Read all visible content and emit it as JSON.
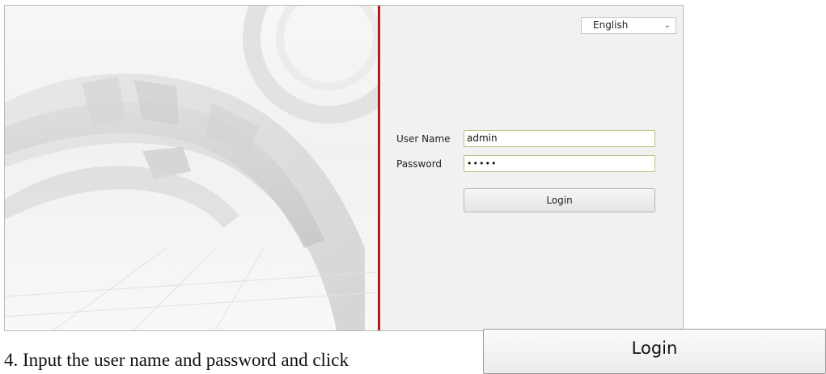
{
  "login_panel": {
    "language": {
      "selected": "English",
      "chevron_icon": "chevron-down-icon"
    },
    "fields": {
      "username_label": "User Name",
      "username_value": "admin",
      "password_label": "Password",
      "password_value": "•••••"
    },
    "login_label": "Login"
  },
  "instruction": {
    "text": "4. Input the user name and password and click",
    "button_label": "Login"
  },
  "colors": {
    "divider": "#b51c1c",
    "panel_bg": "#f1f1f1",
    "input_border": "#bcc58a"
  }
}
